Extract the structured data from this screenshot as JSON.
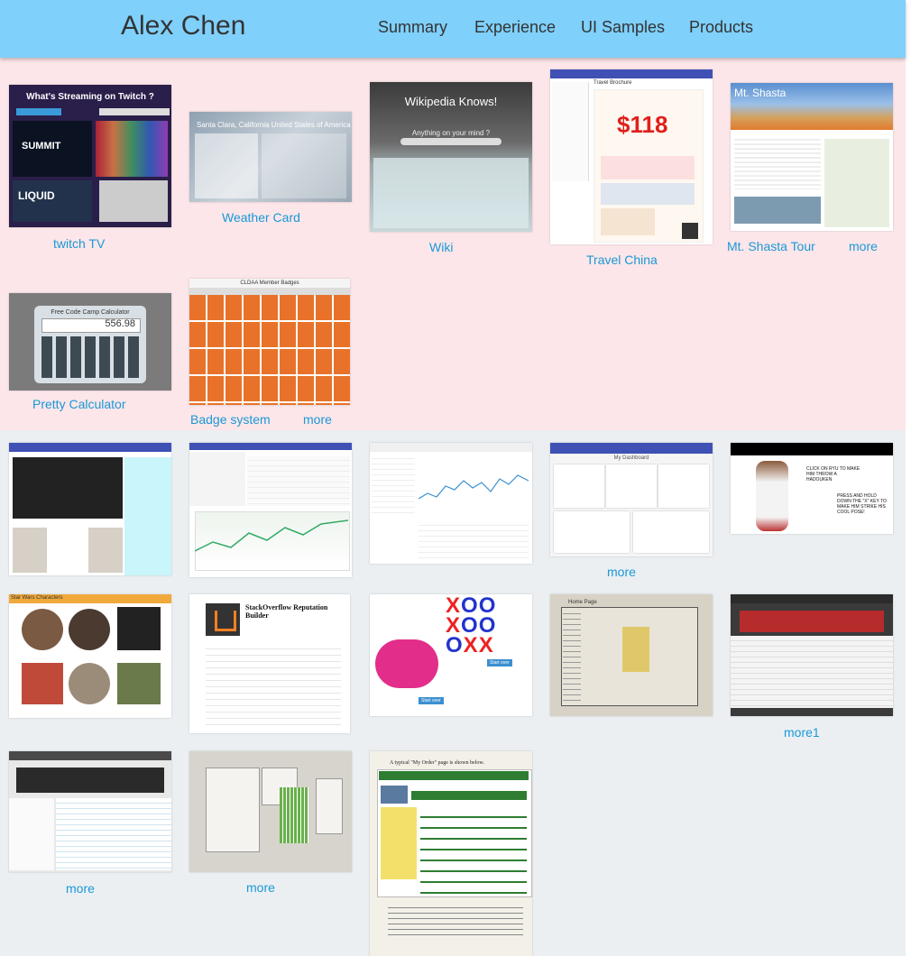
{
  "header": {
    "brand": "Alex Chen",
    "nav": [
      "Summary",
      "Experience",
      "UI Samples",
      "Products"
    ]
  },
  "colors": {
    "header": "#7fd0fb",
    "section1": "#fce6e9",
    "section2": "#ebeff2",
    "link": "#1a98d6"
  },
  "section1": {
    "captions": [
      "twitch TV",
      "Weather Card",
      "Wiki",
      "Travel China",
      "Mt. Shasta Tour",
      "more",
      "Pretty Calculator",
      "Badge system",
      "more"
    ],
    "thumb_text": {
      "twitch_title": "What's Streaming on Twitch ?",
      "twitch_tag": "SUMMIT",
      "twitch_tag2": "LIQUID",
      "weather_city": "Santa Clara, California United States of America",
      "wiki_title": "Wikipedia Knows!",
      "wiki_sub": "Anything on your mind ?",
      "china_price": "$118",
      "china_sub": "Travel Brochure",
      "shasta_title": "Mt. Shasta",
      "calc_title": "Free Code Camp Calculator",
      "calc_display": "556.98",
      "badge_title": "CLDAA Member Badges"
    }
  },
  "section2": {
    "captions": [
      "more",
      "more1",
      "more",
      "more"
    ],
    "thumb_text": {
      "dashboard": "My Dashboard",
      "hadouken1": "CLICK ON RYU TO MAKE HIM THROW A HADOUKEN",
      "hadouken2": "PRESS AND HOLD DOWN THE \"X\" KEY TO MAKE HIM STRIKE HIS COOL POSE!",
      "starwars": "Star Wars Characters",
      "so_title": "StackOverflow Reputation Builder",
      "ttt_btn": "Start over",
      "home_page": "Home Page",
      "order_note": "A typical \"My Order\" page is shown below."
    }
  }
}
